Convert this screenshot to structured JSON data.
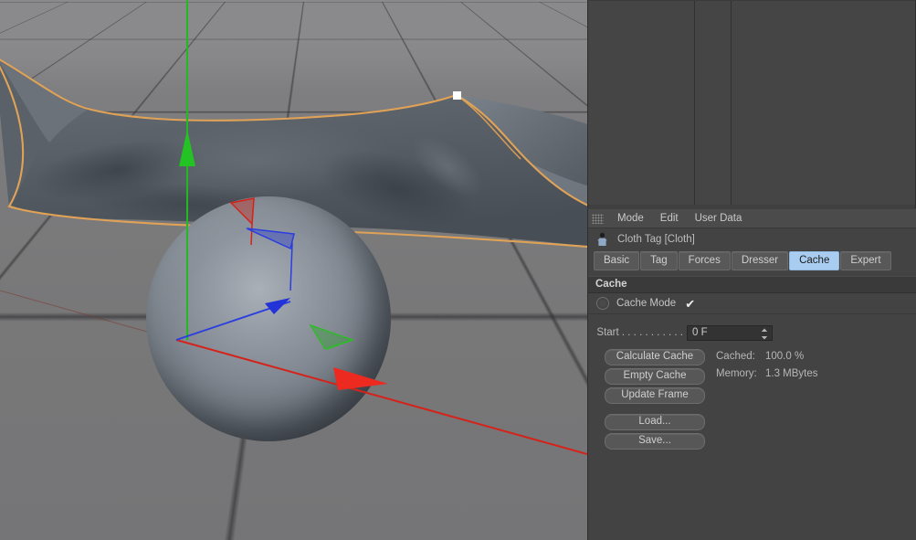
{
  "viewport": {
    "name": "3d-viewport",
    "scene_objects": [
      {
        "name": "cloth-mesh",
        "label": "Cloth",
        "selected": true,
        "outline_color": "#e0a256"
      },
      {
        "name": "collider-sphere",
        "label": "Sphere",
        "selected": false
      },
      {
        "name": "ground-grid",
        "label": "Grid"
      }
    ],
    "gizmo": {
      "name": "axis-gizmo",
      "axes": [
        {
          "axis": "X",
          "color": "#e01f16"
        },
        {
          "axis": "Y",
          "color": "#1fcc1f"
        },
        {
          "axis": "Z",
          "color": "#2a3de0"
        }
      ]
    },
    "colors": {
      "sky": "#8a8a8c",
      "floor": "#7a7a7c",
      "grid_line": "#2d2d2f",
      "selection_outline": "#e0a256",
      "mesh_surface": "#5f666e"
    }
  },
  "object_manager": {
    "name": "object-manager",
    "items": [],
    "columns": 3
  },
  "attributes": {
    "menubar": {
      "grip_icon": "grip-dots-icon",
      "items": [
        {
          "label": "Mode"
        },
        {
          "label": "Edit"
        },
        {
          "label": "User Data"
        }
      ]
    },
    "header": {
      "icon": "cloth-tag-icon",
      "title": "Cloth Tag [Cloth]"
    },
    "tabs": [
      {
        "label": "Basic",
        "selected": false
      },
      {
        "label": "Tag",
        "selected": false
      },
      {
        "label": "Forces",
        "selected": false
      },
      {
        "label": "Dresser",
        "selected": false
      },
      {
        "label": "Cache",
        "selected": true
      },
      {
        "label": "Expert",
        "selected": false
      }
    ],
    "group_title": "Cache",
    "cache_mode": {
      "radio_icon": "radio-circle-icon",
      "label": "Cache Mode",
      "checked": true,
      "check_glyph": "✔"
    },
    "start": {
      "label": "Start . . . . . . . . . . .",
      "value": "0 F",
      "spinner_icon": "spinner-updown-icon"
    },
    "buttons": [
      {
        "label": "Calculate Cache",
        "name": "calculate-cache-button"
      },
      {
        "label": "Empty Cache",
        "name": "empty-cache-button"
      },
      {
        "label": "Update Frame",
        "name": "update-frame-button"
      },
      {
        "label": "Load...",
        "name": "load-button"
      },
      {
        "label": "Save...",
        "name": "save-button"
      }
    ],
    "info": [
      {
        "key": "Cached:",
        "value": "100.0 %"
      },
      {
        "key": "Memory:",
        "value": "1.3 MBytes"
      }
    ],
    "colors": {
      "panel_bg": "#434343",
      "tab_selected": "#a9cdf0",
      "text": "#c4c4c4"
    }
  }
}
